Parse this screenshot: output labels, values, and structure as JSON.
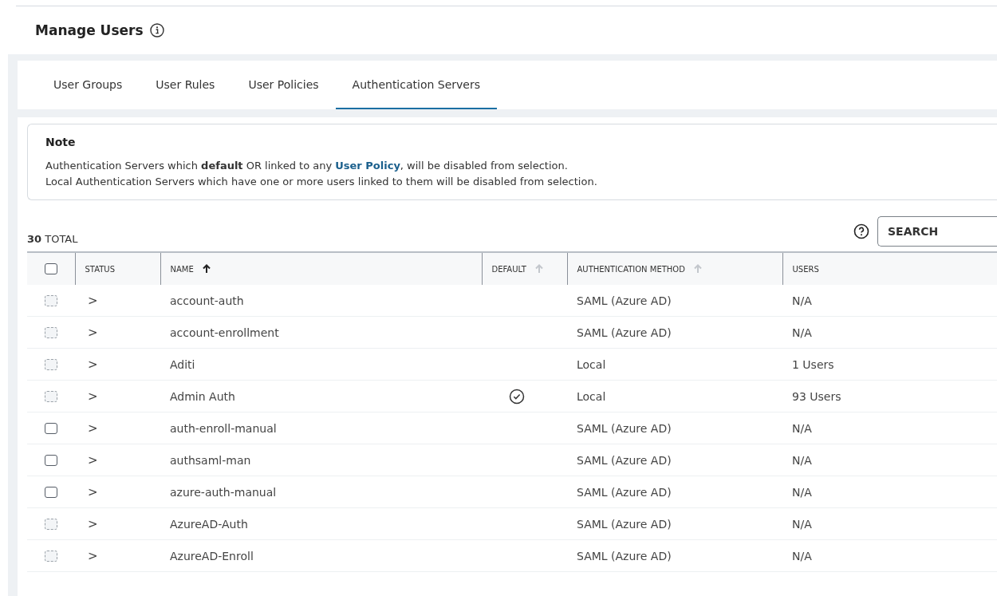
{
  "page": {
    "title": "Manage Users"
  },
  "tabs": [
    {
      "label": "User Groups",
      "selected": false
    },
    {
      "label": "User Rules",
      "selected": false
    },
    {
      "label": "User Policies",
      "selected": false
    },
    {
      "label": "Authentication Servers",
      "selected": true
    }
  ],
  "note": {
    "title": "Note",
    "lines": [
      [
        {
          "kind": "plain",
          "text": "Authentication Servers which "
        },
        {
          "kind": "bold",
          "text": "default"
        },
        {
          "kind": "plain",
          "text": " OR linked to any "
        },
        {
          "kind": "link",
          "text": "User Policy"
        },
        {
          "kind": "plain",
          "text": ", will be disabled from selection."
        }
      ],
      [
        {
          "kind": "plain",
          "text": "Local Authentication Servers which have one or more users linked to them will be disabled from selection."
        }
      ]
    ]
  },
  "total": {
    "count": "30",
    "label": "TOTAL"
  },
  "search": {
    "placeholder": "SEARCH"
  },
  "table": {
    "select_all": {
      "checked": false
    },
    "columns": [
      {
        "label": "STATUS"
      },
      {
        "label": "NAME",
        "sorted": true
      },
      {
        "label": "DEFAULT",
        "sorted": false
      },
      {
        "label": "AUTHENTICATION METHOD",
        "sorted": false
      },
      {
        "label": "USERS"
      }
    ],
    "rows": [
      {
        "checked": false,
        "disabled": true,
        "expander": ">",
        "name": "account-auth",
        "default": false,
        "method": "SAML (Azure AD)",
        "users": "N/A"
      },
      {
        "checked": false,
        "disabled": true,
        "expander": ">",
        "name": "account-enrollment",
        "default": false,
        "method": "SAML (Azure AD)",
        "users": "N/A"
      },
      {
        "checked": false,
        "disabled": true,
        "expander": ">",
        "name": "Aditi",
        "default": false,
        "method": "Local",
        "users": "1 Users"
      },
      {
        "checked": false,
        "disabled": true,
        "expander": ">",
        "name": "Admin Auth",
        "default": true,
        "method": "Local",
        "users": "93 Users"
      },
      {
        "checked": false,
        "disabled": false,
        "expander": ">",
        "name": "auth-enroll-manual",
        "default": false,
        "method": "SAML (Azure AD)",
        "users": "N/A"
      },
      {
        "checked": false,
        "disabled": false,
        "expander": ">",
        "name": "authsaml-man",
        "default": false,
        "method": "SAML (Azure AD)",
        "users": "N/A"
      },
      {
        "checked": false,
        "disabled": false,
        "expander": ">",
        "name": "azure-auth-manual",
        "default": false,
        "method": "SAML (Azure AD)",
        "users": "N/A"
      },
      {
        "checked": false,
        "disabled": true,
        "expander": ">",
        "name": "AzureAD-Auth",
        "default": false,
        "method": "SAML (Azure AD)",
        "users": "N/A"
      },
      {
        "checked": false,
        "disabled": true,
        "expander": ">",
        "name": "AzureAD-Enroll",
        "default": false,
        "method": "SAML (Azure AD)",
        "users": "N/A"
      }
    ]
  }
}
